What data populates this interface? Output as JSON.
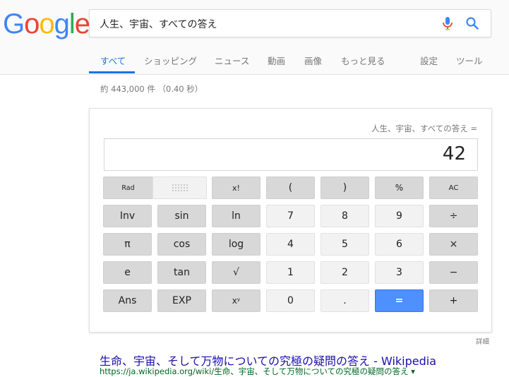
{
  "logo": {
    "text": "Google",
    "letters": [
      "G",
      "o",
      "o",
      "g",
      "l",
      "e"
    ],
    "colors": [
      "#4285f4",
      "#ea4335",
      "#fbbc05",
      "#4285f4",
      "#34a853",
      "#ea4335"
    ]
  },
  "search": {
    "query": "人生、宇宙、すべての答え",
    "mic_icon": "mic-icon",
    "search_icon": "search-icon"
  },
  "tabs": {
    "all": "すべて",
    "shopping": "ショッピング",
    "news": "ニュース",
    "videos": "動画",
    "images": "画像",
    "more": "もっと見る",
    "settings": "設定",
    "tools": "ツール"
  },
  "stats": "約 443,000 件 （0.40 秒）",
  "calculator": {
    "expression": "人生、宇宙、すべての答え =",
    "result": "42",
    "buttons": {
      "rad": "Rad",
      "fact": "x!",
      "lparen": "(",
      "rparen": ")",
      "percent": "%",
      "ac": "AC",
      "inv": "Inv",
      "sin": "sin",
      "ln": "ln",
      "n7": "7",
      "n8": "8",
      "n9": "9",
      "div": "÷",
      "pi": "π",
      "cos": "cos",
      "log": "log",
      "n4": "4",
      "n5": "5",
      "n6": "6",
      "mul": "×",
      "e": "e",
      "tan": "tan",
      "sqrt": "√",
      "n1": "1",
      "n2": "2",
      "n3": "3",
      "minus": "−",
      "ans": "Ans",
      "exp": "EXP",
      "xy": "xʸ",
      "n0": "0",
      "dot": ".",
      "equals": "=",
      "plus": "+"
    },
    "accent_color": "#4d90fe"
  },
  "details": "詳細",
  "result1": {
    "title": "生命、宇宙、そして万物についての究極の疑問の答え - Wikipedia",
    "url": "https://ja.wikipedia.org/wiki/生命、宇宙、そして万物についての究極の疑問の答え ▾"
  }
}
